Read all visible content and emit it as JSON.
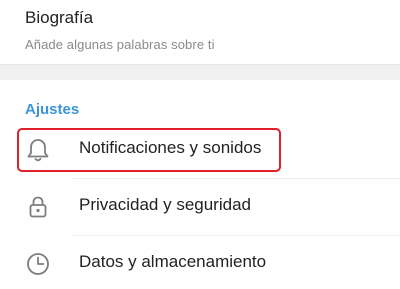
{
  "bio": {
    "title": "Biografía",
    "subtitle": "Añade algunas palabras sobre ti"
  },
  "settings": {
    "header": "Ajustes",
    "items": [
      {
        "label": "Notificaciones y sonidos",
        "icon": "bell-icon"
      },
      {
        "label": "Privacidad y seguridad",
        "icon": "lock-icon"
      },
      {
        "label": "Datos y almacenamiento",
        "icon": "clock-icon"
      }
    ]
  },
  "colors": {
    "accent": "#3b95d6",
    "highlight": "#e0202a"
  }
}
